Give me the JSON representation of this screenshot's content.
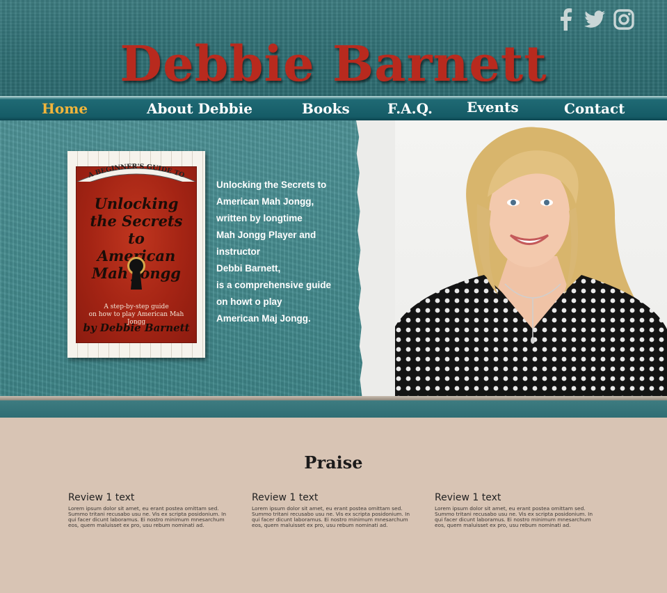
{
  "header": {
    "site_title": "Debbie Barnett",
    "social": [
      {
        "icon": "facebook-icon"
      },
      {
        "icon": "twitter-icon"
      },
      {
        "icon": "instagram-icon"
      }
    ]
  },
  "nav": {
    "items": [
      {
        "label": "Home",
        "active": true
      },
      {
        "label": "About Debbie",
        "active": false
      },
      {
        "label": "Books",
        "active": false
      },
      {
        "label": "F.A.Q.",
        "active": false
      },
      {
        "label": "Events",
        "active": false
      },
      {
        "label": "Contact",
        "active": false
      }
    ],
    "active_color": "#f2b53b"
  },
  "book": {
    "banner": "A BEGINNER'S GUIDE TO",
    "title_lines": [
      "Unlocking",
      "the Secrets to",
      "American",
      "Mah Jongg"
    ],
    "subtitle_lines": [
      "A step-by-step guide",
      "on how to play American Mah Jongg"
    ],
    "author": "by Debbie Barnett"
  },
  "hero": {
    "lines": [
      "Unlocking the Secrets to",
      "American Mah Jongg,",
      "written by longtime",
      "Mah Jongg Player and",
      "instructor",
      "Debbi Barnett,",
      "is a comprehensive guide",
      "on howt o play",
      "American Maj Jongg."
    ]
  },
  "praise": {
    "heading": "Praise",
    "reviews": [
      {
        "title": "Review 1 text",
        "body": "Lorem ipsum dolor sit amet, eu erant postea omittam sed. Summo tritani recusabo usu ne. Vis ex scripta posidonium. In qui facer dicunt laboramus. Ei nostro minimum mnesarchum eos, quem maluisset ex pro, usu rebum nominati ad."
      },
      {
        "title": "Review 1 text",
        "body": "Lorem ipsum dolor sit amet, eu erant postea omittam sed. Summo tritani recusabo usu ne. Vis ex scripta posidonium. In qui facer dicunt laboramus. Ei nostro minimum mnesarchum eos, quem maluisset ex pro, usu rebum nominati ad."
      },
      {
        "title": "Review 1 text",
        "body": "Lorem ipsum dolor sit amet, eu erant postea omittam sed. Summo tritani recusabo usu ne. Vis ex scripta posidonium. In qui facer dicunt laboramus. Ei nostro minimum mnesarchum eos, quem maluisset ex pro, usu rebum nominati ad."
      }
    ]
  },
  "colors": {
    "title_red": "#b82a1e",
    "teal": "#3e8588",
    "beige": "#d8c4b4"
  }
}
